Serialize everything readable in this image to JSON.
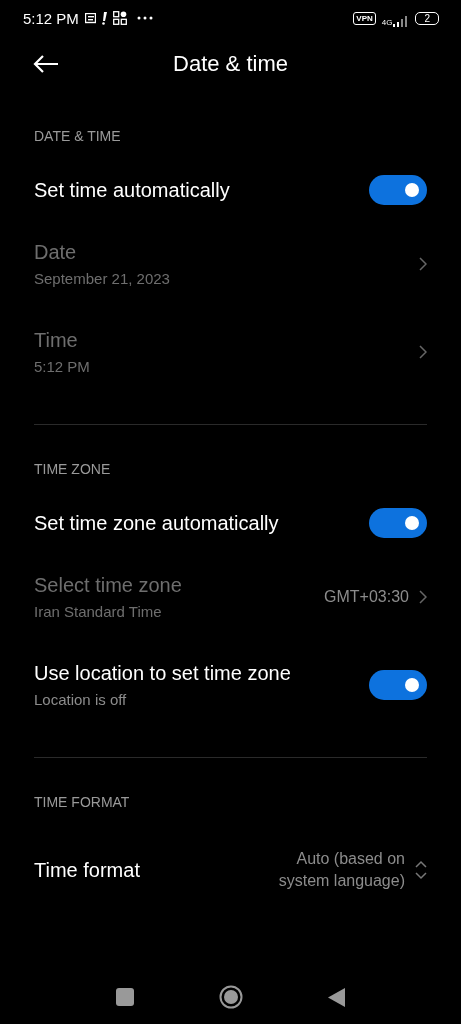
{
  "status_bar": {
    "time": "5:12 PM",
    "vpn": "VPN",
    "network": "4G",
    "battery": "2"
  },
  "header": {
    "title": "Date & time"
  },
  "sections": [
    {
      "title": "DATE & TIME",
      "items": [
        {
          "kind": "toggle",
          "title": "Set time automatically",
          "on": true,
          "disabled": false
        },
        {
          "kind": "link",
          "title": "Date",
          "subtitle": "September 21, 2023",
          "disabled": true
        },
        {
          "kind": "link",
          "title": "Time",
          "subtitle": "5:12 PM",
          "disabled": true
        }
      ]
    },
    {
      "title": "TIME ZONE",
      "items": [
        {
          "kind": "toggle",
          "title": "Set time zone automatically",
          "on": true,
          "disabled": false
        },
        {
          "kind": "link",
          "title": "Select time zone",
          "subtitle": "Iran Standard Time",
          "value": "GMT+03:30",
          "disabled": true
        },
        {
          "kind": "toggle",
          "title": "Use location to set time zone",
          "subtitle": "Location is off",
          "on": true,
          "disabled": false
        }
      ]
    },
    {
      "title": "TIME FORMAT",
      "items": [
        {
          "kind": "select",
          "title": "Time format",
          "value": "Auto (based on system language)",
          "disabled": false
        }
      ]
    }
  ]
}
